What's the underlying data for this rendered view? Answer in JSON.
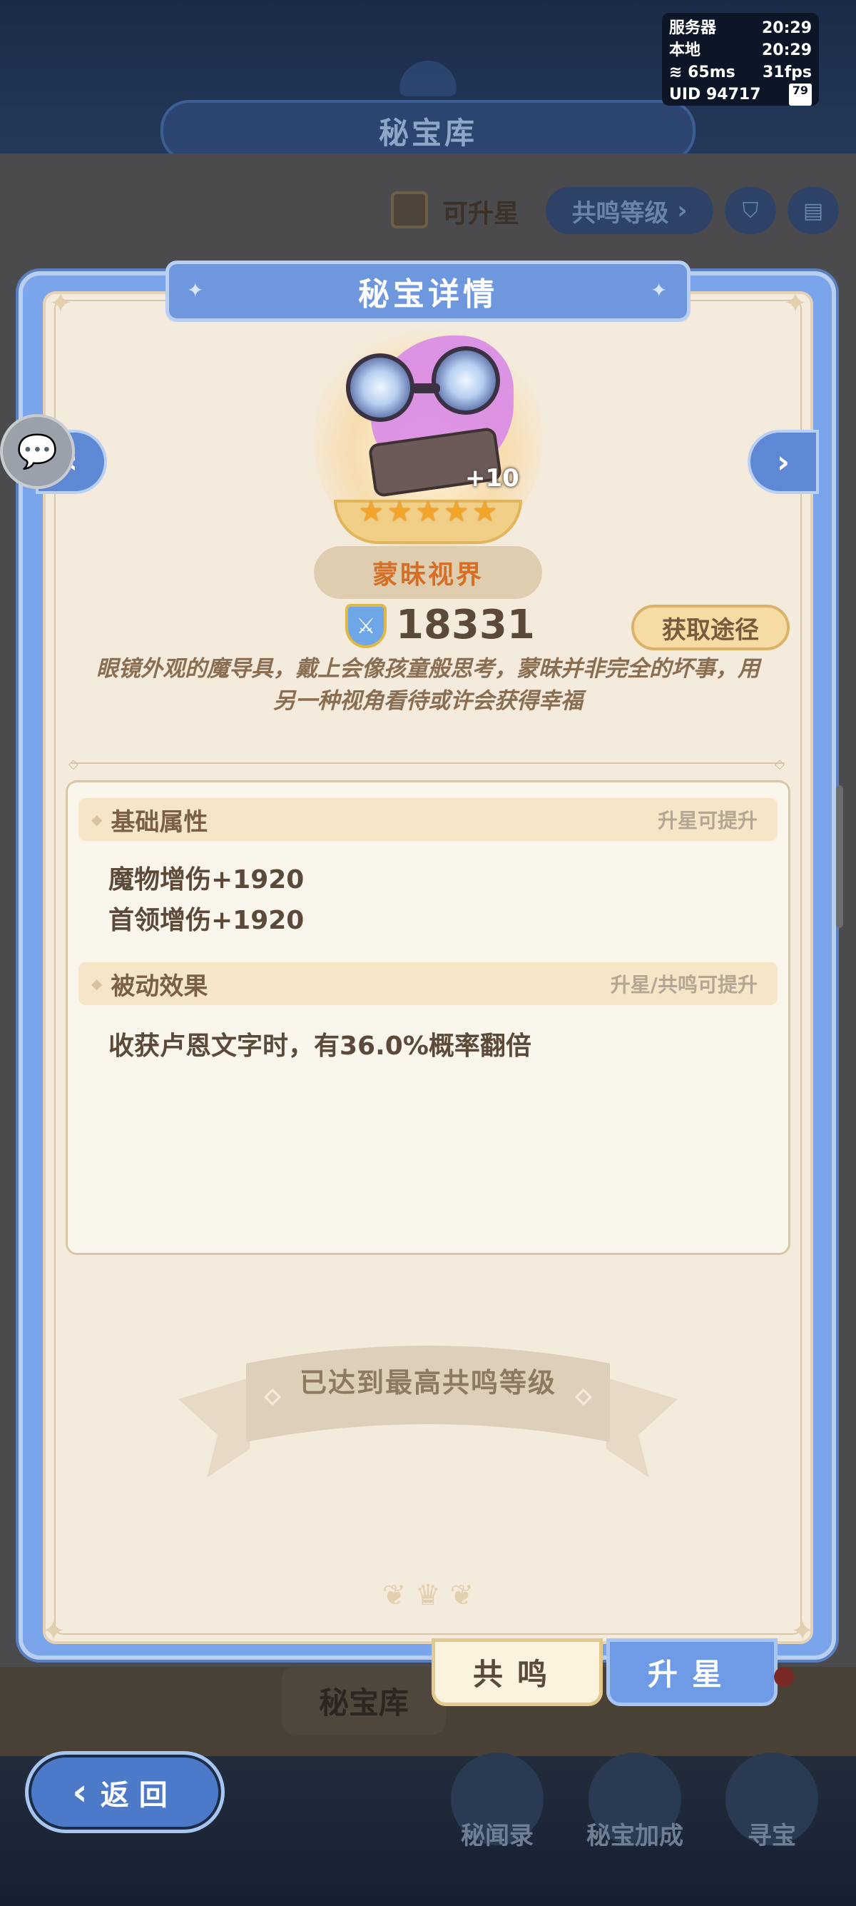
{
  "status": {
    "server_label": "服务器",
    "server_time": "20:29",
    "local_label": "本地",
    "local_time": "20:29",
    "ping": "65ms",
    "fps": "31fps",
    "uid": "UID 94717",
    "battery": "79"
  },
  "background": {
    "title": "秘宝库",
    "filter_checkbox_label": "可升星",
    "sort_label": "共鸣等级",
    "tab_label": "秘宝库",
    "bottom_buttons": [
      "秘闻录",
      "秘宝加成",
      "寻宝"
    ],
    "back_label": "返回"
  },
  "modal": {
    "title": "秘宝详情",
    "artifact": {
      "name": "蒙昧视界",
      "level": "+10",
      "stars": 5,
      "power": "18331",
      "description": "眼镜外观的魔导具，戴上会像孩童般思考，蒙昧并非完全的坏事，用另一种视角看待或许会获得幸福"
    },
    "obtain_label": "获取途径",
    "basic_section": {
      "title": "基础属性",
      "hint": "升星可提升",
      "lines": [
        "魔物增伤+1920",
        "首领增伤+1920"
      ]
    },
    "passive_section": {
      "title": "被动效果",
      "hint": "升星/共鸣可提升",
      "lines": [
        "收获卢恩文字时，有36.0%概率翻倍"
      ]
    },
    "max_banner": "已达到最高共鸣等级",
    "tabs": {
      "resonance": "共鸣",
      "upgrade": "升星"
    }
  },
  "colors": {
    "frame_blue": "#7aa5ea",
    "panel_cream": "#f4ebdd",
    "name_orange": "#d46f25",
    "star_gold": "#f3a52a"
  }
}
